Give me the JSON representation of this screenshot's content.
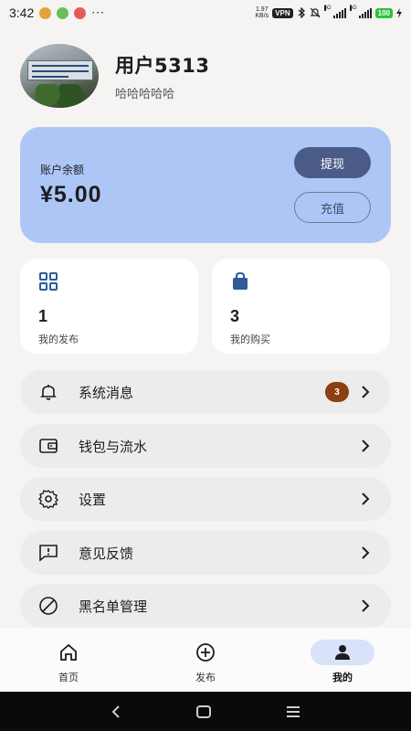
{
  "status_bar": {
    "time": "3:42",
    "more": "···",
    "net_speed_value": "1.97",
    "net_speed_unit": "KB/s",
    "vpn": "VPN",
    "signal_1": "5G",
    "signal_2": "5G",
    "battery": "100"
  },
  "profile": {
    "username": "用户5313",
    "bio": "哈哈哈哈哈"
  },
  "balance": {
    "label": "账户余额",
    "amount": "¥5.00",
    "withdraw_label": "提现",
    "recharge_label": "充值"
  },
  "stats": [
    {
      "icon": "grid-icon",
      "value": "1",
      "label": "我的发布"
    },
    {
      "icon": "shopping-bag-icon",
      "value": "3",
      "label": "我的购买"
    }
  ],
  "menu": [
    {
      "icon": "bell-icon",
      "label": "系统消息",
      "badge": "3"
    },
    {
      "icon": "wallet-icon",
      "label": "钱包与流水"
    },
    {
      "icon": "gear-icon",
      "label": "设置"
    },
    {
      "icon": "feedback-icon",
      "label": "意见反馈"
    },
    {
      "icon": "block-icon",
      "label": "黑名单管理"
    }
  ],
  "bottom_nav": [
    {
      "icon": "home-icon",
      "label": "首页",
      "active": false
    },
    {
      "icon": "add-circle-icon",
      "label": "发布",
      "active": false
    },
    {
      "icon": "person-icon",
      "label": "我的",
      "active": true
    }
  ],
  "colors": {
    "background": "#f6f4f2",
    "balance_card": "#adc6f6",
    "withdraw_button": "#4a5b88",
    "badge": "#8b3f12",
    "stat_icon": "#2e5a98",
    "active_tab": "#d8e2f9"
  }
}
